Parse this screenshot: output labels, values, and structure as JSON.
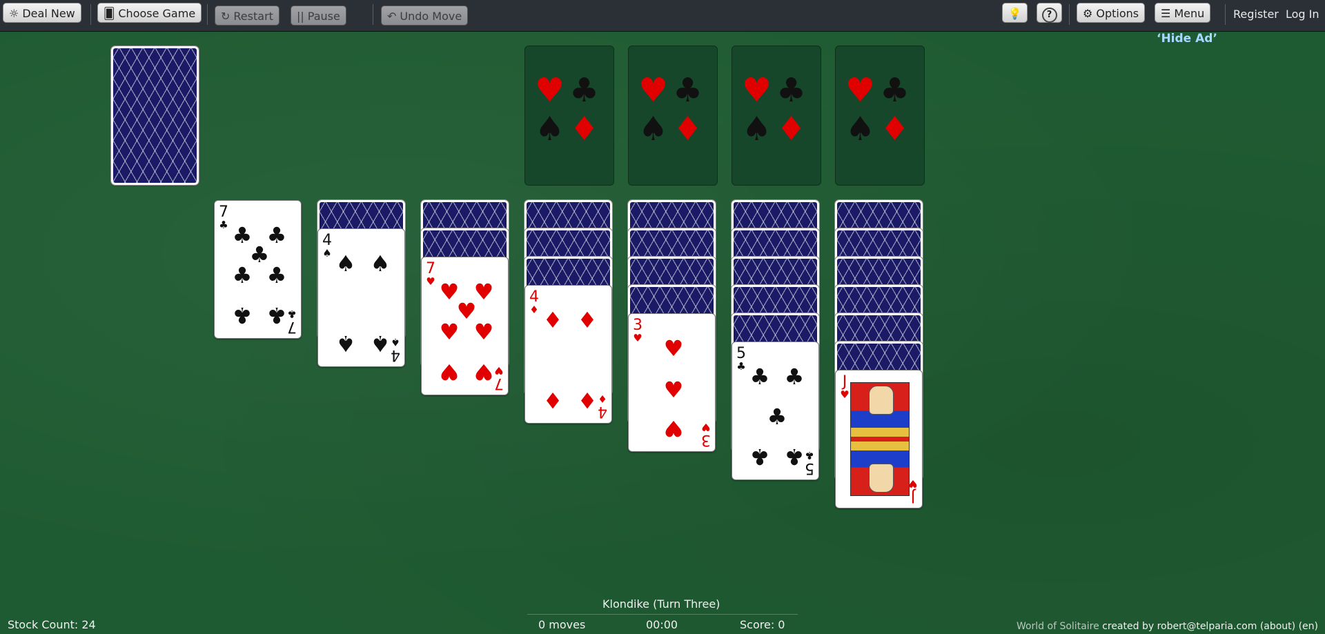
{
  "toolbar": {
    "deal_new": "Deal New",
    "choose_game": "Choose Game",
    "restart": "Restart",
    "pause": "Pause",
    "undo_move": "Undo Move",
    "hint_icon": "lightbulb-icon",
    "help_icon": "help-icon",
    "options": "Options",
    "menu": "Menu",
    "register": "Register",
    "login": "Log In"
  },
  "hide_ad": "‘Hide Ad’",
  "foundation_placeholder": [
    "♥",
    "♣",
    "♠",
    "♦"
  ],
  "tableau": [
    {
      "face_down": 0,
      "face_up": [
        {
          "rank": "7",
          "suit": "♣"
        }
      ]
    },
    {
      "face_down": 1,
      "face_up": [
        {
          "rank": "4",
          "suit": "♠"
        }
      ]
    },
    {
      "face_down": 2,
      "face_up": [
        {
          "rank": "7",
          "suit": "♥"
        }
      ]
    },
    {
      "face_down": 3,
      "face_up": [
        {
          "rank": "4",
          "suit": "♦"
        }
      ]
    },
    {
      "face_down": 4,
      "face_up": [
        {
          "rank": "3",
          "suit": "♥"
        }
      ]
    },
    {
      "face_down": 5,
      "face_up": [
        {
          "rank": "5",
          "suit": "♣"
        }
      ]
    },
    {
      "face_down": 6,
      "face_up": [
        {
          "rank": "J",
          "suit": "♥"
        }
      ]
    }
  ],
  "status": {
    "game_name": "Klondike (Turn Three)",
    "stock_count": "Stock Count: 24",
    "moves": "0 moves",
    "time": "00:00",
    "score": "Score: 0"
  },
  "credit": {
    "site": "World of Solitaire",
    "created_by": "created by robert@telparia.com (about) (en)"
  },
  "colors": {
    "felt": "#1f5b32",
    "red_suit": "#e00000",
    "card_back": "#1a1a66"
  }
}
